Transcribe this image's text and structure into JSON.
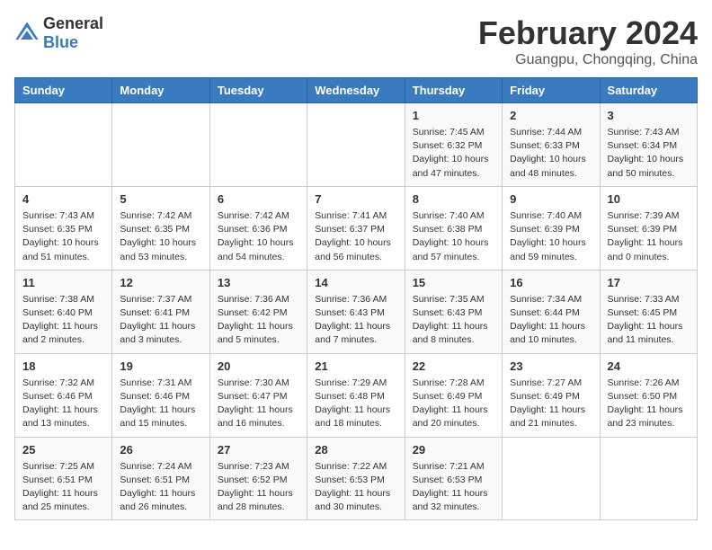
{
  "logo": {
    "text_general": "General",
    "text_blue": "Blue"
  },
  "header": {
    "month_year": "February 2024",
    "location": "Guangpu, Chongqing, China"
  },
  "days_of_week": [
    "Sunday",
    "Monday",
    "Tuesday",
    "Wednesday",
    "Thursday",
    "Friday",
    "Saturday"
  ],
  "weeks": [
    [
      {
        "day": "",
        "info": ""
      },
      {
        "day": "",
        "info": ""
      },
      {
        "day": "",
        "info": ""
      },
      {
        "day": "",
        "info": ""
      },
      {
        "day": "1",
        "info": "Sunrise: 7:45 AM\nSunset: 6:32 PM\nDaylight: 10 hours and 47 minutes."
      },
      {
        "day": "2",
        "info": "Sunrise: 7:44 AM\nSunset: 6:33 PM\nDaylight: 10 hours and 48 minutes."
      },
      {
        "day": "3",
        "info": "Sunrise: 7:43 AM\nSunset: 6:34 PM\nDaylight: 10 hours and 50 minutes."
      }
    ],
    [
      {
        "day": "4",
        "info": "Sunrise: 7:43 AM\nSunset: 6:35 PM\nDaylight: 10 hours and 51 minutes."
      },
      {
        "day": "5",
        "info": "Sunrise: 7:42 AM\nSunset: 6:35 PM\nDaylight: 10 hours and 53 minutes."
      },
      {
        "day": "6",
        "info": "Sunrise: 7:42 AM\nSunset: 6:36 PM\nDaylight: 10 hours and 54 minutes."
      },
      {
        "day": "7",
        "info": "Sunrise: 7:41 AM\nSunset: 6:37 PM\nDaylight: 10 hours and 56 minutes."
      },
      {
        "day": "8",
        "info": "Sunrise: 7:40 AM\nSunset: 6:38 PM\nDaylight: 10 hours and 57 minutes."
      },
      {
        "day": "9",
        "info": "Sunrise: 7:40 AM\nSunset: 6:39 PM\nDaylight: 10 hours and 59 minutes."
      },
      {
        "day": "10",
        "info": "Sunrise: 7:39 AM\nSunset: 6:39 PM\nDaylight: 11 hours and 0 minutes."
      }
    ],
    [
      {
        "day": "11",
        "info": "Sunrise: 7:38 AM\nSunset: 6:40 PM\nDaylight: 11 hours and 2 minutes."
      },
      {
        "day": "12",
        "info": "Sunrise: 7:37 AM\nSunset: 6:41 PM\nDaylight: 11 hours and 3 minutes."
      },
      {
        "day": "13",
        "info": "Sunrise: 7:36 AM\nSunset: 6:42 PM\nDaylight: 11 hours and 5 minutes."
      },
      {
        "day": "14",
        "info": "Sunrise: 7:36 AM\nSunset: 6:43 PM\nDaylight: 11 hours and 7 minutes."
      },
      {
        "day": "15",
        "info": "Sunrise: 7:35 AM\nSunset: 6:43 PM\nDaylight: 11 hours and 8 minutes."
      },
      {
        "day": "16",
        "info": "Sunrise: 7:34 AM\nSunset: 6:44 PM\nDaylight: 11 hours and 10 minutes."
      },
      {
        "day": "17",
        "info": "Sunrise: 7:33 AM\nSunset: 6:45 PM\nDaylight: 11 hours and 11 minutes."
      }
    ],
    [
      {
        "day": "18",
        "info": "Sunrise: 7:32 AM\nSunset: 6:46 PM\nDaylight: 11 hours and 13 minutes."
      },
      {
        "day": "19",
        "info": "Sunrise: 7:31 AM\nSunset: 6:46 PM\nDaylight: 11 hours and 15 minutes."
      },
      {
        "day": "20",
        "info": "Sunrise: 7:30 AM\nSunset: 6:47 PM\nDaylight: 11 hours and 16 minutes."
      },
      {
        "day": "21",
        "info": "Sunrise: 7:29 AM\nSunset: 6:48 PM\nDaylight: 11 hours and 18 minutes."
      },
      {
        "day": "22",
        "info": "Sunrise: 7:28 AM\nSunset: 6:49 PM\nDaylight: 11 hours and 20 minutes."
      },
      {
        "day": "23",
        "info": "Sunrise: 7:27 AM\nSunset: 6:49 PM\nDaylight: 11 hours and 21 minutes."
      },
      {
        "day": "24",
        "info": "Sunrise: 7:26 AM\nSunset: 6:50 PM\nDaylight: 11 hours and 23 minutes."
      }
    ],
    [
      {
        "day": "25",
        "info": "Sunrise: 7:25 AM\nSunset: 6:51 PM\nDaylight: 11 hours and 25 minutes."
      },
      {
        "day": "26",
        "info": "Sunrise: 7:24 AM\nSunset: 6:51 PM\nDaylight: 11 hours and 26 minutes."
      },
      {
        "day": "27",
        "info": "Sunrise: 7:23 AM\nSunset: 6:52 PM\nDaylight: 11 hours and 28 minutes."
      },
      {
        "day": "28",
        "info": "Sunrise: 7:22 AM\nSunset: 6:53 PM\nDaylight: 11 hours and 30 minutes."
      },
      {
        "day": "29",
        "info": "Sunrise: 7:21 AM\nSunset: 6:53 PM\nDaylight: 11 hours and 32 minutes."
      },
      {
        "day": "",
        "info": ""
      },
      {
        "day": "",
        "info": ""
      }
    ]
  ]
}
